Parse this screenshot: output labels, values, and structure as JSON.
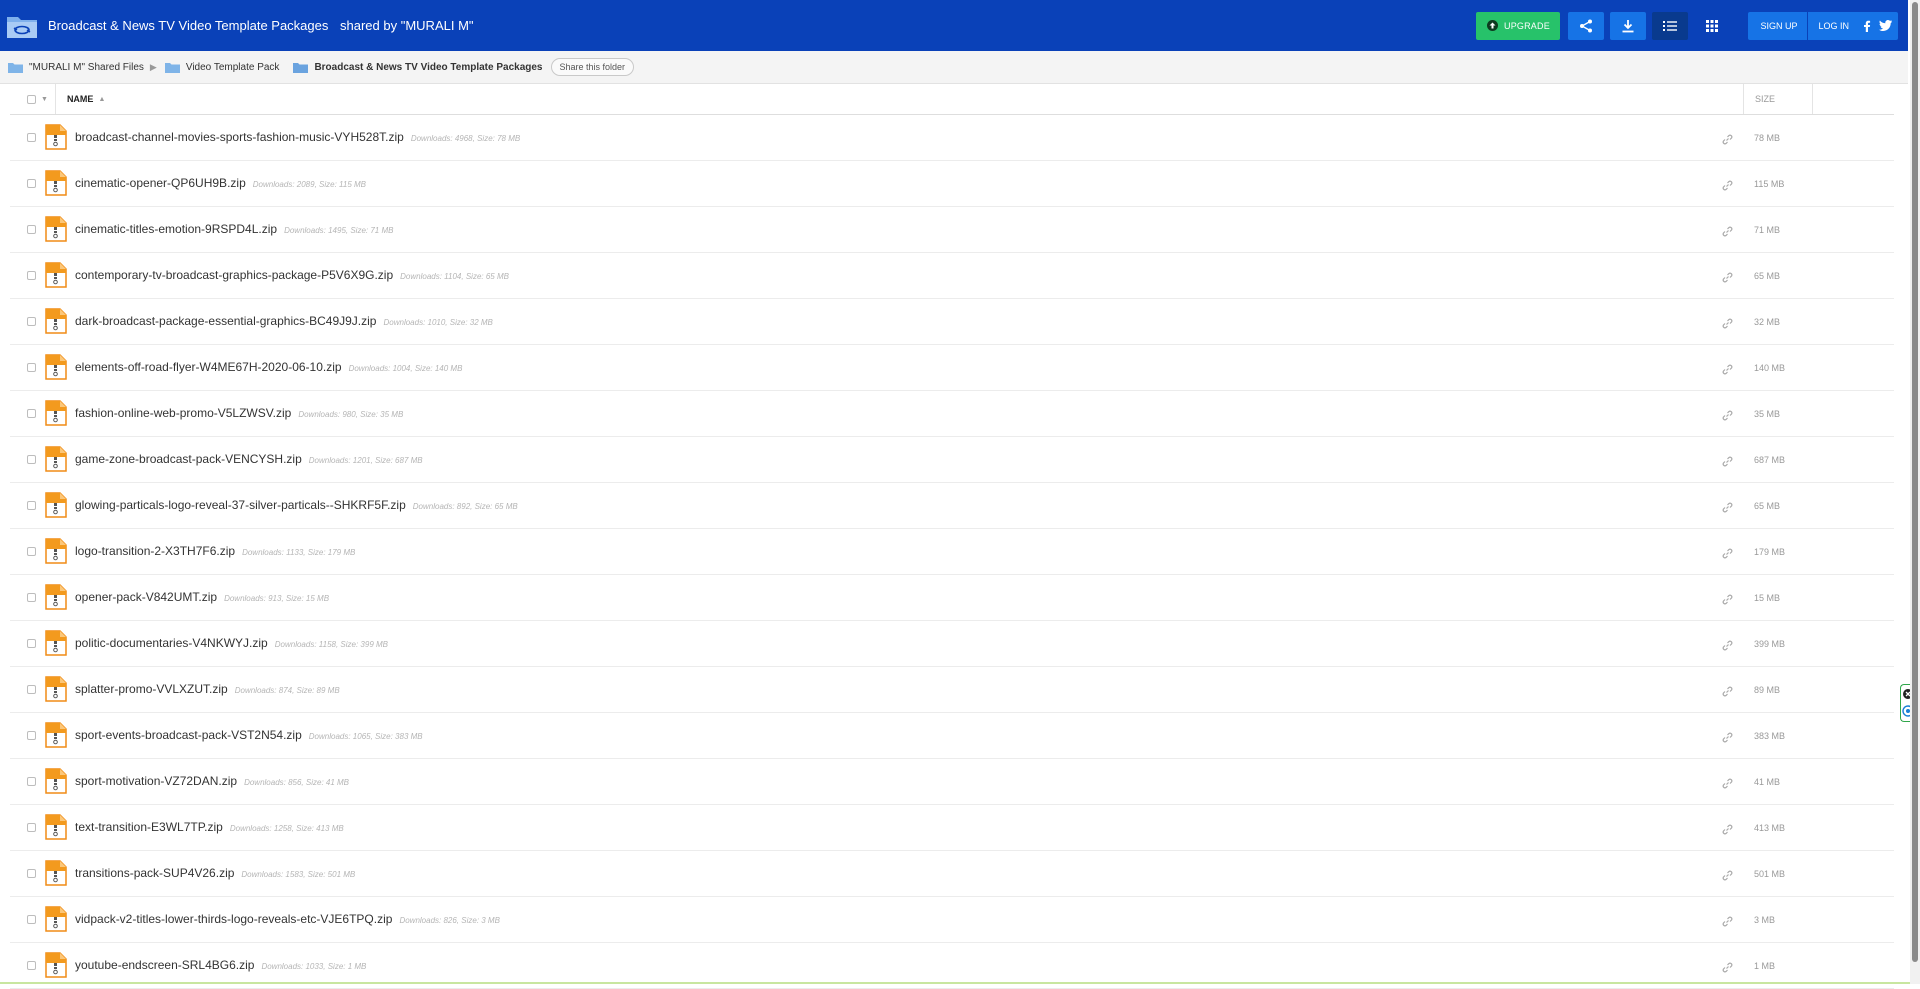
{
  "header": {
    "folder_title": "Broadcast & News TV Video Template Packages",
    "shared_by": "shared by \"MURALI M\"",
    "upgrade_label": "UPGRADE",
    "signup_label": "SIGN UP",
    "login_label": "LOG IN"
  },
  "icons": {
    "share": "share-icon",
    "download": "download-icon",
    "list_view": "list-view-icon",
    "grid_view": "grid-icon",
    "facebook": "facebook-icon",
    "twitter": "twitter-icon"
  },
  "colors": {
    "header_bg": "#0a41b8",
    "button_blue": "#1673e6",
    "upgrade_green": "#27c26a"
  },
  "breadcrumb": {
    "items": [
      "\"MURALI M\" Shared Files",
      "Video Template Pack"
    ],
    "current": "Broadcast & News TV Video Template Packages",
    "share_folder": "Share this folder"
  },
  "table": {
    "name_header": "NAME",
    "size_header": "SIZE",
    "files": [
      {
        "name": "broadcast-channel-movies-sports-fashion-music-VYH528T.zip",
        "meta": "Downloads: 4968, Size: 78 MB",
        "size": "78 MB"
      },
      {
        "name": "cinematic-opener-QP6UH9B.zip",
        "meta": "Downloads: 2089, Size: 115 MB",
        "size": "115 MB"
      },
      {
        "name": "cinematic-titles-emotion-9RSPD4L.zip",
        "meta": "Downloads: 1495, Size: 71 MB",
        "size": "71 MB"
      },
      {
        "name": "contemporary-tv-broadcast-graphics-package-P5V6X9G.zip",
        "meta": "Downloads: 1104, Size: 65 MB",
        "size": "65 MB"
      },
      {
        "name": "dark-broadcast-package-essential-graphics-BC49J9J.zip",
        "meta": "Downloads: 1010, Size: 32 MB",
        "size": "32 MB"
      },
      {
        "name": "elements-off-road-flyer-W4ME67H-2020-06-10.zip",
        "meta": "Downloads: 1004, Size: 140 MB",
        "size": "140 MB"
      },
      {
        "name": "fashion-online-web-promo-V5LZWSV.zip",
        "meta": "Downloads: 980, Size: 35 MB",
        "size": "35 MB"
      },
      {
        "name": "game-zone-broadcast-pack-VENCYSH.zip",
        "meta": "Downloads: 1201, Size: 687 MB",
        "size": "687 MB"
      },
      {
        "name": "glowing-particals-logo-reveal-37-silver-particals--SHKRF5F.zip",
        "meta": "Downloads: 892, Size: 65 MB",
        "size": "65 MB"
      },
      {
        "name": "logo-transition-2-X3TH7F6.zip",
        "meta": "Downloads: 1133, Size: 179 MB",
        "size": "179 MB"
      },
      {
        "name": "opener-pack-V842UMT.zip",
        "meta": "Downloads: 913, Size: 15 MB",
        "size": "15 MB"
      },
      {
        "name": "politic-documentaries-V4NKWYJ.zip",
        "meta": "Downloads: 1158, Size: 399 MB",
        "size": "399 MB"
      },
      {
        "name": "splatter-promo-VVLXZUT.zip",
        "meta": "Downloads: 874, Size: 89 MB",
        "size": "89 MB"
      },
      {
        "name": "sport-events-broadcast-pack-VST2N54.zip",
        "meta": "Downloads: 1065, Size: 383 MB",
        "size": "383 MB"
      },
      {
        "name": "sport-motivation-VZ72DAN.zip",
        "meta": "Downloads: 856, Size: 41 MB",
        "size": "41 MB"
      },
      {
        "name": "text-transition-E3WL7TP.zip",
        "meta": "Downloads: 1258, Size: 413 MB",
        "size": "413 MB"
      },
      {
        "name": "transitions-pack-SUP4V26.zip",
        "meta": "Downloads: 1583, Size: 501 MB",
        "size": "501 MB"
      },
      {
        "name": "vidpack-v2-titles-lower-thirds-logo-reveals-etc-VJE6TPQ.zip",
        "meta": "Downloads: 826, Size: 3 MB",
        "size": "3 MB"
      },
      {
        "name": "youtube-endscreen-SRL4BG6.zip",
        "meta": "Downloads: 1033, Size: 1 MB",
        "size": "1 MB"
      }
    ]
  }
}
